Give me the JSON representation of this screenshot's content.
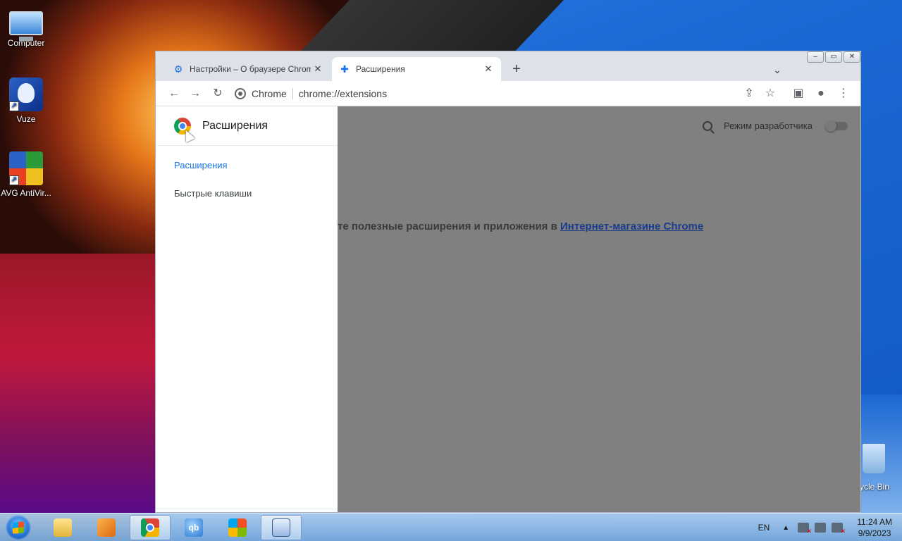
{
  "desktop": {
    "icons": [
      {
        "label": "Computer"
      },
      {
        "label": "Vuze"
      },
      {
        "label": "AVG AntiVir..."
      }
    ],
    "recycle_label": "ycle Bin"
  },
  "browser": {
    "tabs": [
      {
        "title": "Настройки – О браузере Chrome",
        "icon": "gear-icon"
      },
      {
        "title": "Расширения",
        "icon": "puzzle-icon"
      }
    ],
    "omnibox": {
      "chip": "Chrome",
      "url": "chrome://extensions"
    }
  },
  "extensions_page": {
    "drawer": {
      "title": "Расширения",
      "items": [
        {
          "label": "Расширения",
          "active": true
        },
        {
          "label": "Быстрые клавиши",
          "active": false
        }
      ]
    },
    "dev_mode_label": "Режим разработчика",
    "dev_mode_enabled": false,
    "empty_text": "те полезные расширения и приложения в ",
    "store_link": "Интернет-магазине Chrome"
  },
  "taskbar": {
    "language": "EN",
    "time": "11:24 AM",
    "date": "9/9/2023",
    "qb_label": "qb"
  },
  "colors": {
    "accent": "#1a73e8",
    "overlay": "#808080",
    "link": "#1a3d8a"
  }
}
